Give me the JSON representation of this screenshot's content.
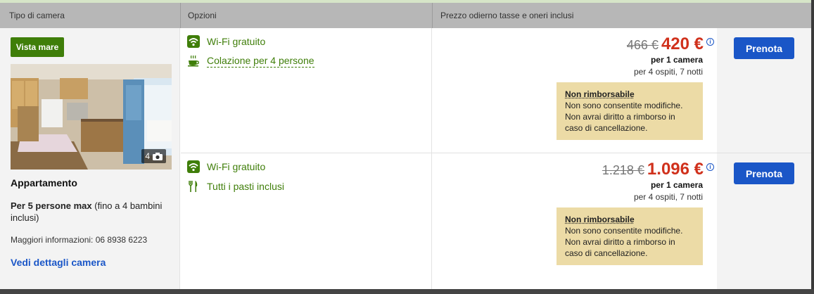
{
  "header": {
    "col_room": "Tipo di camera",
    "col_options": "Opzioni",
    "col_price": "Prezzo odierno tasse e oneri inclusi"
  },
  "room": {
    "badge": "Vista mare",
    "photo_count": "4",
    "name": "Appartamento",
    "capacity_bold": "Per 5 persone max",
    "capacity_rest": " (fino a 4 bambini inclusi)",
    "info": "Maggiori informazioni: 06 8938 6223",
    "details_link": "Vedi dettagli camera"
  },
  "offers": [
    {
      "options": [
        {
          "icon": "wifi-icon",
          "label": "Wi-Fi gratuito"
        },
        {
          "icon": "coffee-cup-icon",
          "label": "Colazione per 4 persone"
        }
      ],
      "old_price": "466 €",
      "new_price": "420 €",
      "per_room": "per 1 camera",
      "guests": "per 4 ospiti, 7 notti",
      "policy_title": "Non rimborsabile",
      "policy_text": "Non sono consentite modifiche. Non avrai diritto a rimborso in caso di cancellazione.",
      "book_label": "Prenota"
    },
    {
      "options": [
        {
          "icon": "wifi-icon",
          "label": "Wi-Fi gratuito"
        },
        {
          "icon": "fork-knife-icon",
          "label": "Tutti i pasti inclusi"
        }
      ],
      "old_price": "1.218 €",
      "new_price": "1.096 €",
      "per_room": "per 1 camera",
      "guests": "per 4 ospiti, 7 notti",
      "policy_title": "Non rimborsabile",
      "policy_text": "Non sono consentite modifiche. Non avrai diritto a rimborso in caso di cancellazione.",
      "book_label": "Prenota"
    }
  ],
  "colors": {
    "accent_green": "#3f7e09",
    "price_red": "#d0311c",
    "button_blue": "#1a56c7",
    "policy_bg": "#ecdba6"
  }
}
